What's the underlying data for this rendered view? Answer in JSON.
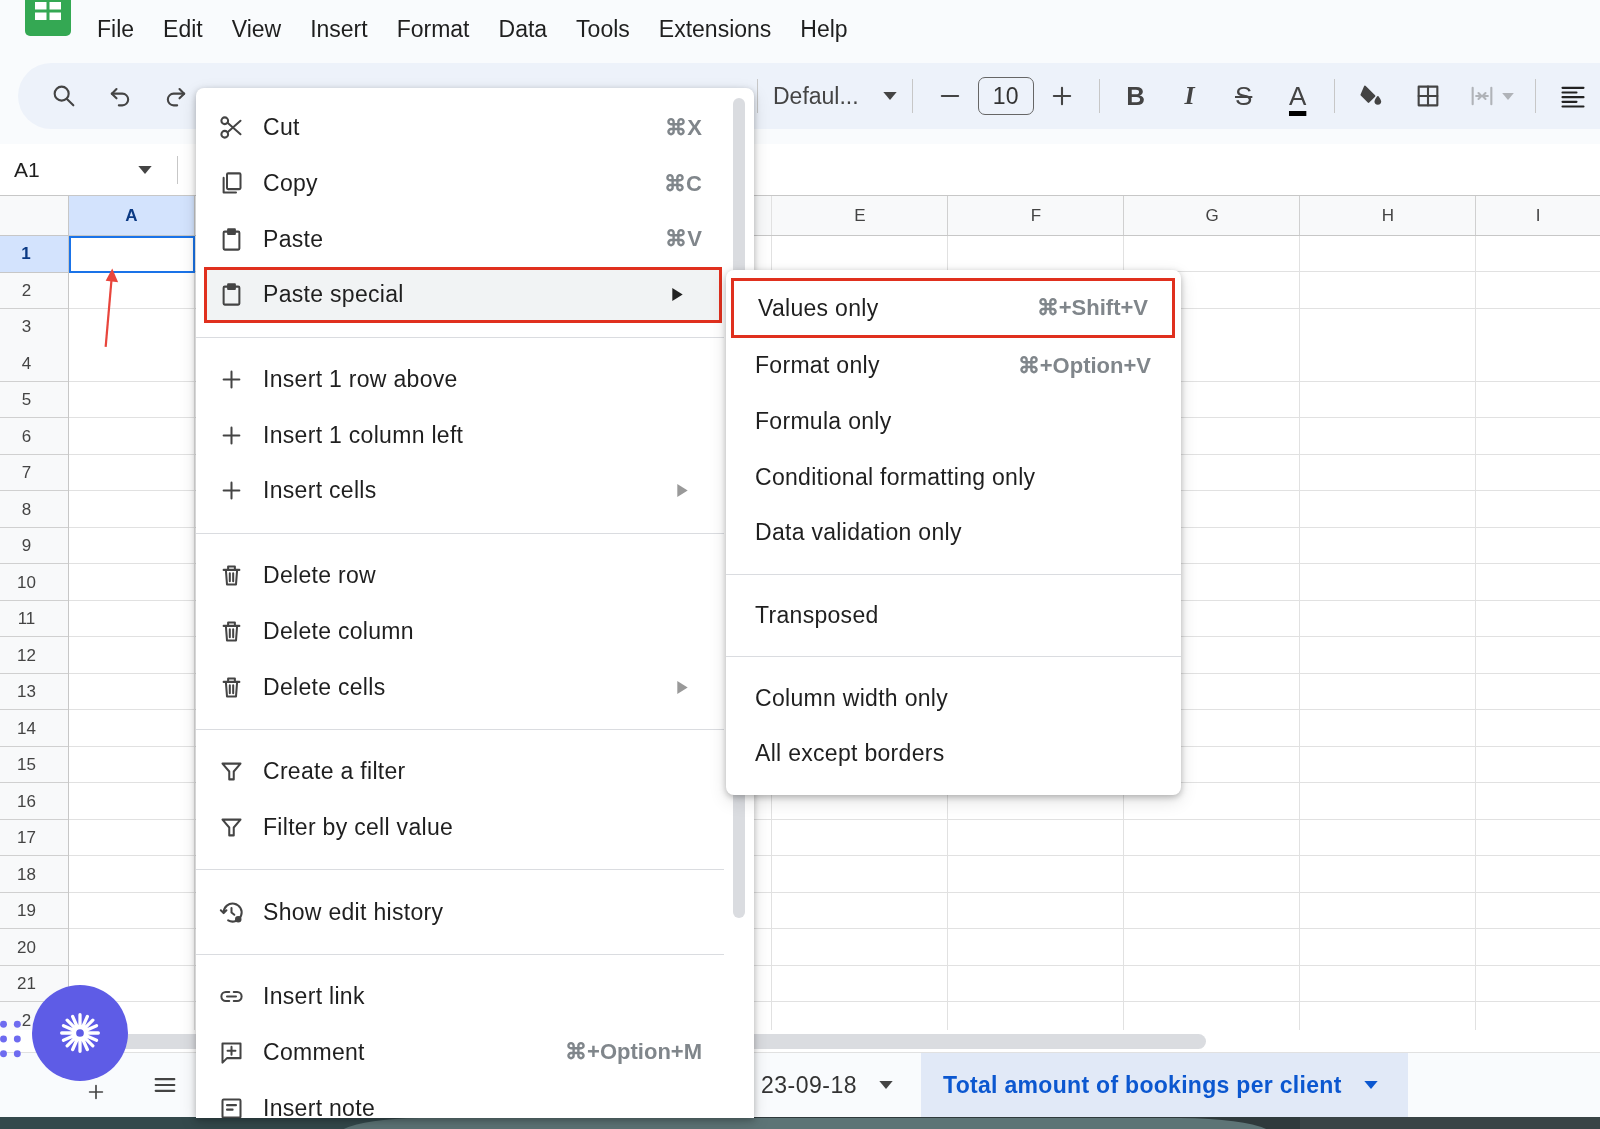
{
  "menu_bar": [
    "File",
    "Edit",
    "View",
    "Insert",
    "Format",
    "Data",
    "Tools",
    "Extensions",
    "Help"
  ],
  "toolbar": {
    "font": "Defaul...",
    "font_size": "10",
    "format_buttons": [
      {
        "kind": "bold",
        "label": "B"
      },
      {
        "kind": "italic",
        "label": "I"
      },
      {
        "kind": "strike",
        "label": "S"
      },
      {
        "kind": "text_color",
        "label": "A"
      }
    ]
  },
  "name_box": "A1",
  "columns": [
    {
      "label": "A",
      "selected": true
    },
    {
      "label": "E",
      "selected": false
    },
    {
      "label": "F",
      "selected": false
    },
    {
      "label": "G",
      "selected": false
    },
    {
      "label": "H",
      "selected": false
    },
    {
      "label": "I",
      "selected": false
    }
  ],
  "rows": [
    {
      "label": "1",
      "selected": true
    },
    {
      "label": "2",
      "selected": false
    },
    {
      "label": "3",
      "selected": false
    },
    {
      "label": "4",
      "selected": false
    },
    {
      "label": "5",
      "selected": false
    },
    {
      "label": "6",
      "selected": false
    },
    {
      "label": "7",
      "selected": false
    },
    {
      "label": "8",
      "selected": false
    },
    {
      "label": "9",
      "selected": false
    },
    {
      "label": "10",
      "selected": false
    },
    {
      "label": "11",
      "selected": false
    },
    {
      "label": "12",
      "selected": false
    },
    {
      "label": "13",
      "selected": false
    },
    {
      "label": "14",
      "selected": false
    },
    {
      "label": "15",
      "selected": false
    },
    {
      "label": "16",
      "selected": false
    },
    {
      "label": "17",
      "selected": false
    },
    {
      "label": "18",
      "selected": false
    },
    {
      "label": "19",
      "selected": false
    },
    {
      "label": "20",
      "selected": false
    },
    {
      "label": "21",
      "selected": false
    },
    {
      "label": "2",
      "selected": false
    }
  ],
  "sheet_tabs": [
    {
      "label": "23-09-18",
      "selected": false
    },
    {
      "label": "Total amount of bookings per client",
      "selected": true
    }
  ],
  "context_menu": [
    {
      "kind": "cut",
      "label": "Cut",
      "shortcut": "⌘X",
      "submenu": false,
      "selected": false
    },
    {
      "kind": "copy",
      "label": "Copy",
      "shortcut": "⌘C",
      "submenu": false,
      "selected": false
    },
    {
      "kind": "paste",
      "label": "Paste",
      "shortcut": "⌘V",
      "submenu": false,
      "selected": false
    },
    {
      "kind": "paste",
      "label": "Paste special",
      "submenu": true,
      "selected": true
    },
    {
      "kind": "divider"
    },
    {
      "kind": "insert",
      "label": "Insert 1 row above",
      "submenu": false,
      "selected": false
    },
    {
      "kind": "insert",
      "label": "Insert 1 column left",
      "submenu": false,
      "selected": false
    },
    {
      "kind": "insert",
      "label": "Insert cells",
      "submenu": true,
      "selected": false
    },
    {
      "kind": "divider"
    },
    {
      "kind": "delete",
      "label": "Delete row",
      "submenu": false,
      "selected": false
    },
    {
      "kind": "delete",
      "label": "Delete column",
      "submenu": false,
      "selected": false
    },
    {
      "kind": "delete",
      "label": "Delete cells",
      "submenu": true,
      "selected": false
    },
    {
      "kind": "divider"
    },
    {
      "kind": "filter",
      "label": "Create a filter",
      "submenu": false,
      "selected": false
    },
    {
      "kind": "filter",
      "label": "Filter by cell value",
      "submenu": false,
      "selected": false
    },
    {
      "kind": "divider"
    },
    {
      "kind": "history",
      "label": "Show edit history",
      "submenu": false,
      "selected": false
    },
    {
      "kind": "divider"
    },
    {
      "kind": "link",
      "label": "Insert link",
      "submenu": false,
      "selected": false
    },
    {
      "kind": "comment",
      "label": "Comment",
      "shortcut": "⌘+Option+M",
      "submenu": false,
      "selected": false
    },
    {
      "kind": "note",
      "label": "Insert note",
      "submenu": false,
      "selected": false
    }
  ],
  "submenu": [
    {
      "kind": "item",
      "label": "Values only",
      "shortcut": "⌘+Shift+V",
      "selected": true
    },
    {
      "kind": "item",
      "label": "Format only",
      "shortcut": "⌘+Option+V",
      "selected": false
    },
    {
      "kind": "item",
      "label": "Formula only",
      "selected": false
    },
    {
      "kind": "item",
      "label": "Conditional formatting only",
      "selected": false
    },
    {
      "kind": "item",
      "label": "Data validation only",
      "selected": false
    },
    {
      "kind": "divider"
    },
    {
      "kind": "item",
      "label": "Transposed",
      "selected": false
    },
    {
      "kind": "divider"
    },
    {
      "kind": "item",
      "label": "Column width only",
      "selected": false
    },
    {
      "kind": "item",
      "label": "All except borders",
      "selected": false
    }
  ]
}
